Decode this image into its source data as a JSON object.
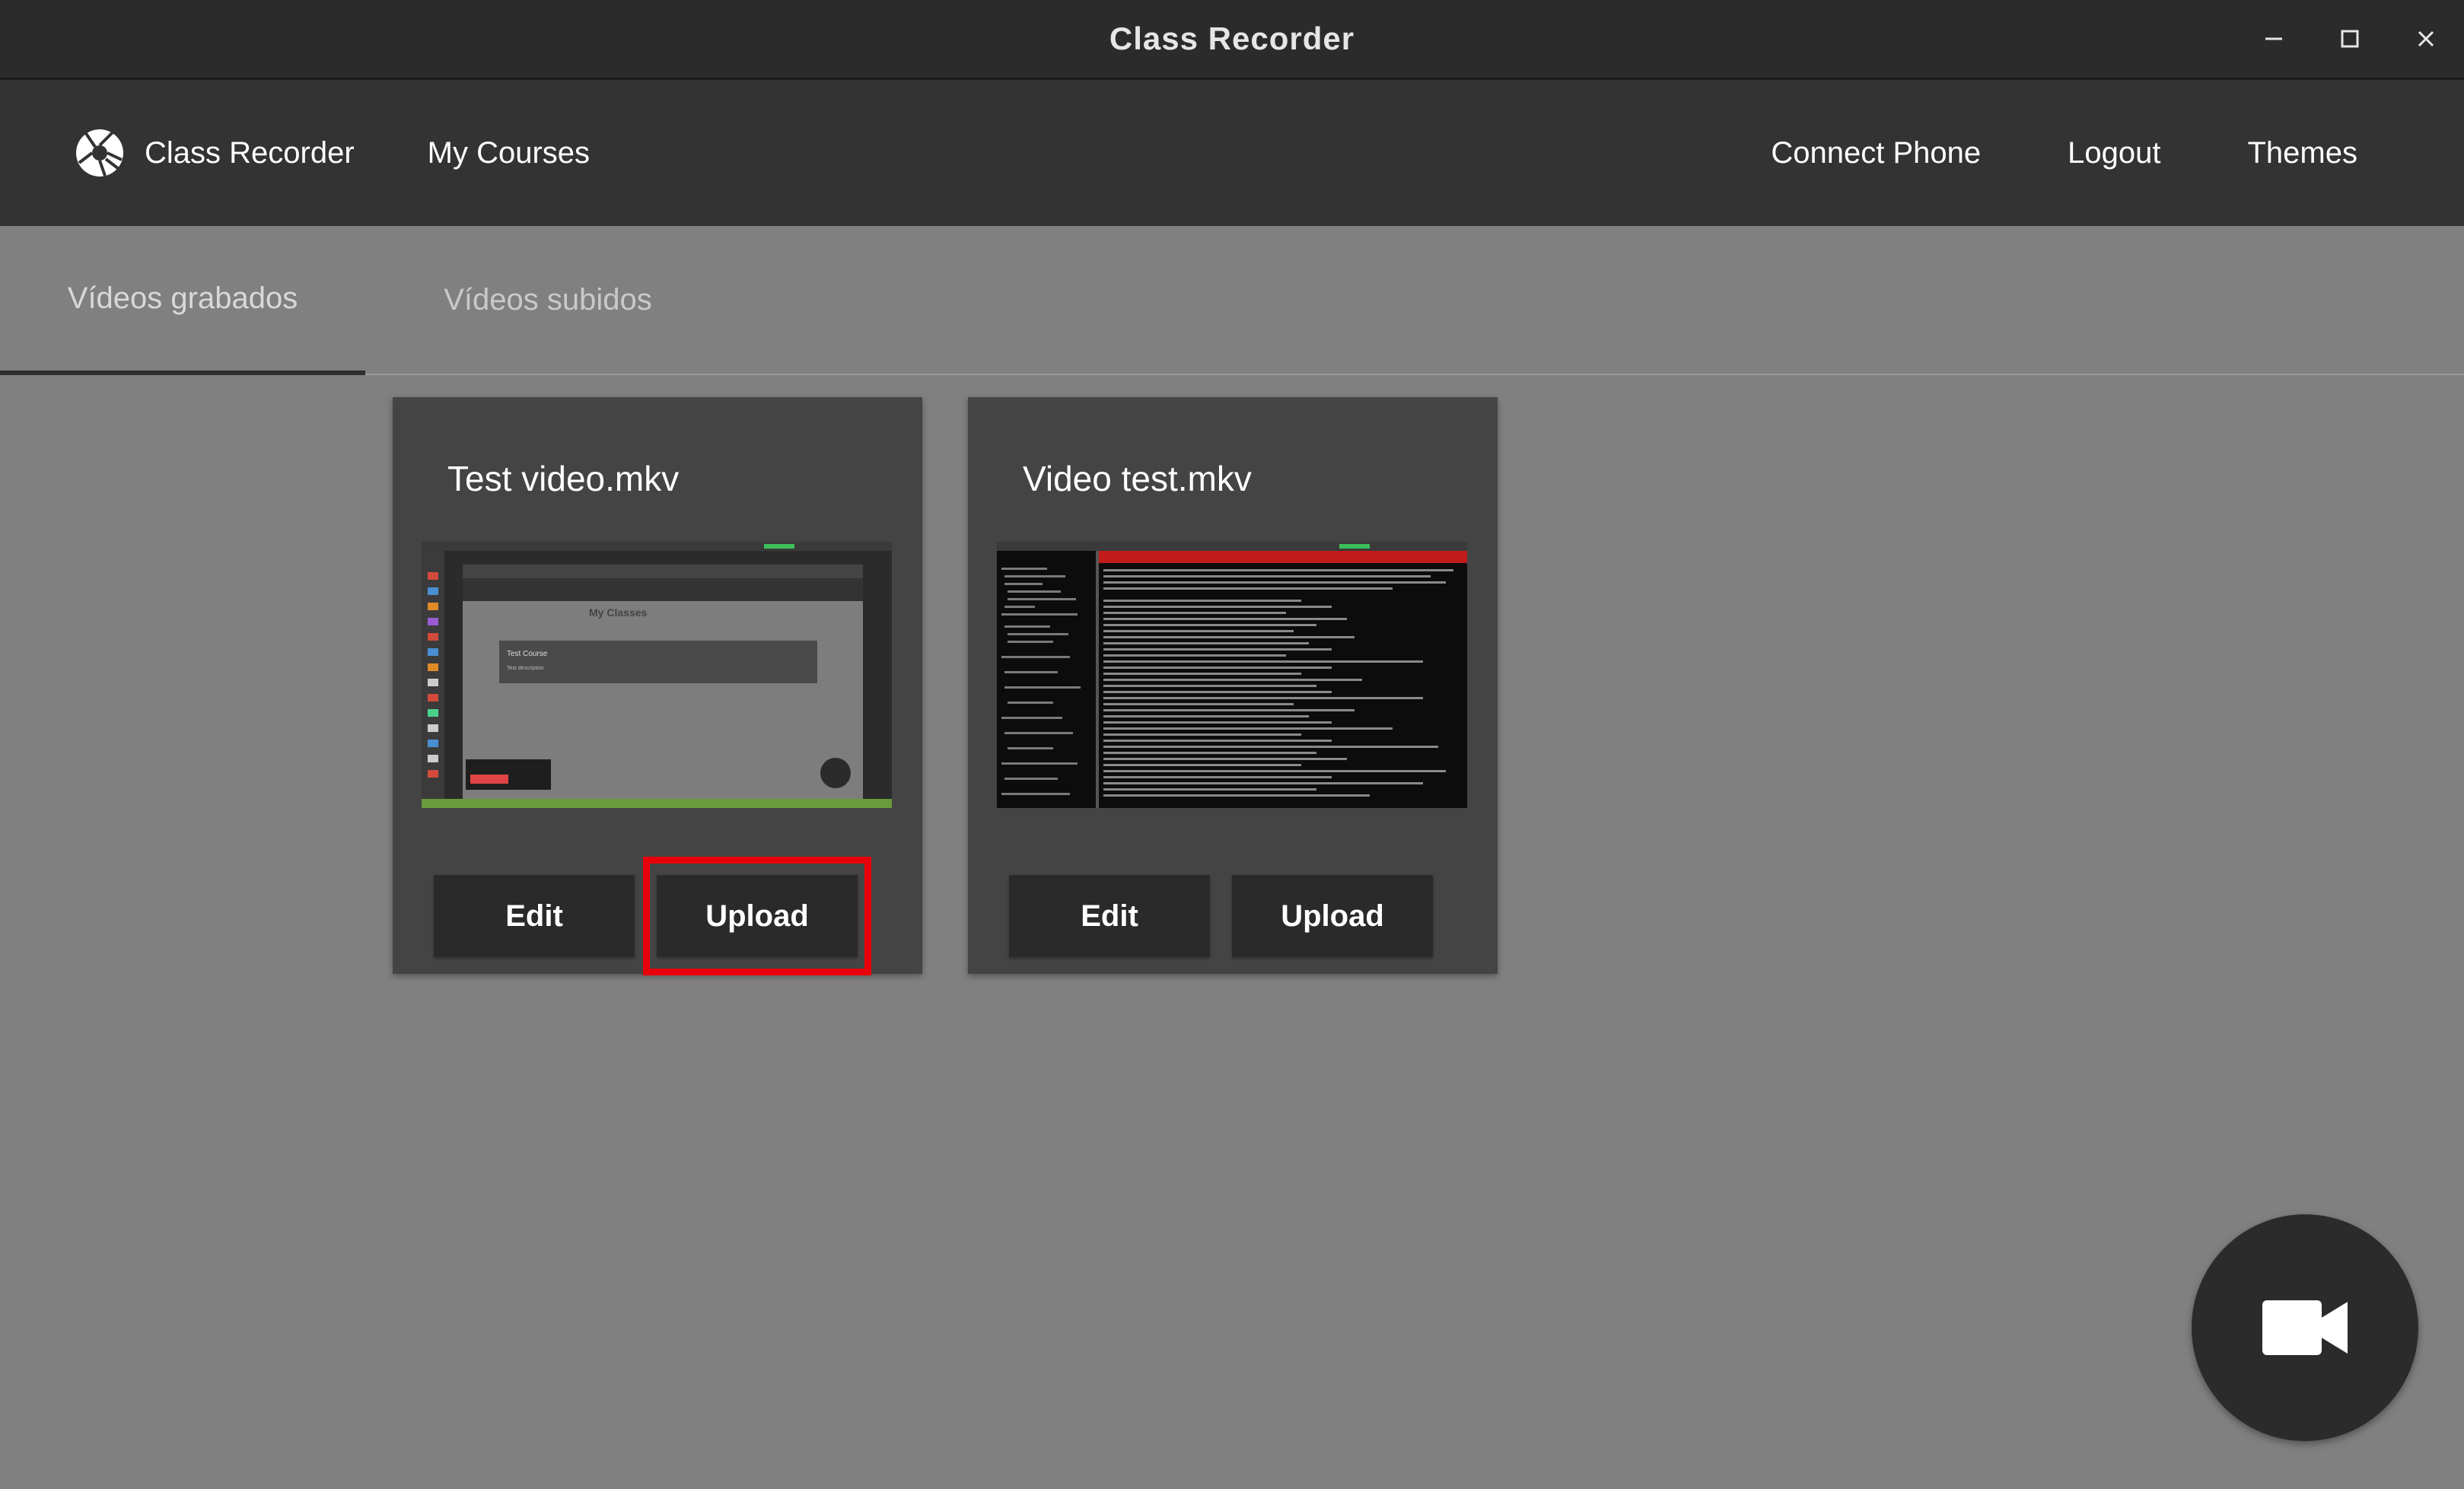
{
  "window": {
    "title": "Class Recorder"
  },
  "navbar": {
    "brand_label": "Class Recorder",
    "my_courses": "My Courses",
    "connect_phone": "Connect Phone",
    "logout": "Logout",
    "themes": "Themes"
  },
  "tabs": [
    {
      "label": "Vídeos grabados",
      "active": true
    },
    {
      "label": "Vídeos subidos",
      "active": false
    }
  ],
  "videos": [
    {
      "filename": "Test video.mkv",
      "edit_label": "Edit",
      "upload_label": "Upload",
      "upload_highlighted": true,
      "thumbnail": {
        "heading": "My Classes",
        "course_title": "Test Course",
        "course_subtitle": "Test description"
      }
    },
    {
      "filename": "Video test.mkv",
      "edit_label": "Edit",
      "upload_label": "Upload",
      "upload_highlighted": false
    }
  ],
  "fab": {
    "icon": "video-camera-icon"
  },
  "colors": {
    "titlebar": "#2b2b2b",
    "navbar": "#333333",
    "background": "#808080",
    "card": "#444444",
    "button": "#2a2a2a",
    "highlight": "#e8000b"
  }
}
